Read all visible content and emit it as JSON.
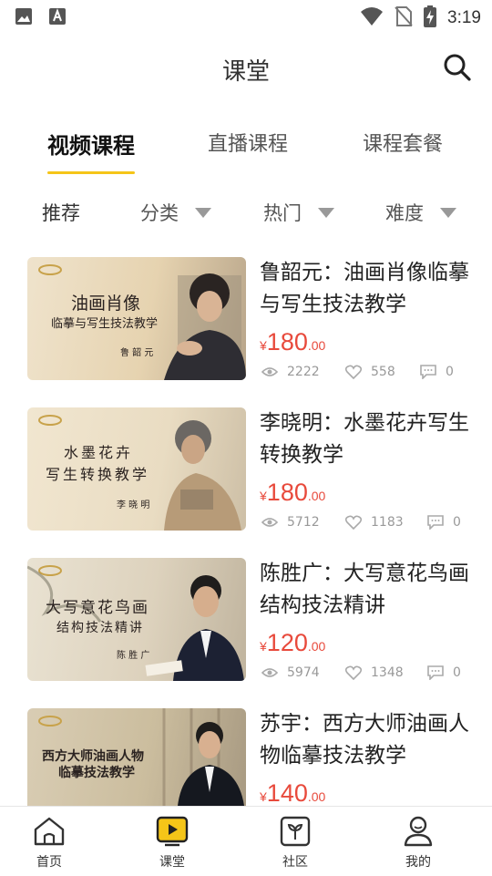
{
  "status_bar": {
    "time": "3:19",
    "left_icons": [
      "image-icon",
      "font-icon"
    ],
    "right_icons": [
      "wifi-icon",
      "no-sim-icon",
      "battery-charging-icon"
    ]
  },
  "header": {
    "title": "课堂",
    "search_icon": "search-icon"
  },
  "tabs": [
    {
      "label": "视频课程",
      "active": true
    },
    {
      "label": "直播课程",
      "active": false
    },
    {
      "label": "课程套餐",
      "active": false
    }
  ],
  "filters": [
    {
      "label": "推荐",
      "dropdown": false
    },
    {
      "label": "分类",
      "dropdown": true
    },
    {
      "label": "热门",
      "dropdown": true
    },
    {
      "label": "难度",
      "dropdown": true
    }
  ],
  "courses": [
    {
      "title": "鲁韶元：油画肖像临摹与写生技法教学",
      "thumb_line1": "油画肖像",
      "thumb_line2": "临摹与写生技法教学",
      "thumb_caption": "鲁 韶 元",
      "price_symbol": "¥",
      "price_int": "180",
      "price_dec": ".00",
      "views": "2222",
      "likes": "558",
      "comments": "0"
    },
    {
      "title": "李晓明：水墨花卉写生转换教学",
      "thumb_line1": "水墨花卉",
      "thumb_line2": "写生转换教学",
      "thumb_caption": "李 晓 明",
      "price_symbol": "¥",
      "price_int": "180",
      "price_dec": ".00",
      "views": "5712",
      "likes": "1183",
      "comments": "0"
    },
    {
      "title": "陈胜广：大写意花鸟画结构技法精讲",
      "thumb_line1": "大写意花鸟画",
      "thumb_line2": "结构技法精讲",
      "thumb_caption": "陈 胜 广",
      "price_symbol": "¥",
      "price_int": "120",
      "price_dec": ".00",
      "views": "5974",
      "likes": "1348",
      "comments": "0"
    },
    {
      "title": "苏宇：西方大师油画人物临摹技法教学",
      "thumb_line1": "西方大师油画人物",
      "thumb_line2": "临摹技法教学",
      "thumb_caption": "",
      "price_symbol": "¥",
      "price_int": "140",
      "price_dec": ".00"
    }
  ],
  "bottom_nav": [
    {
      "label": "首页",
      "icon": "home-icon",
      "active": false
    },
    {
      "label": "课堂",
      "icon": "play-icon",
      "active": true
    },
    {
      "label": "社区",
      "icon": "sprout-icon",
      "active": false
    },
    {
      "label": "我的",
      "icon": "profile-icon",
      "active": false
    }
  ],
  "colors": {
    "accent": "#f5c518",
    "price": "#e84a3c",
    "muted": "#999999"
  }
}
